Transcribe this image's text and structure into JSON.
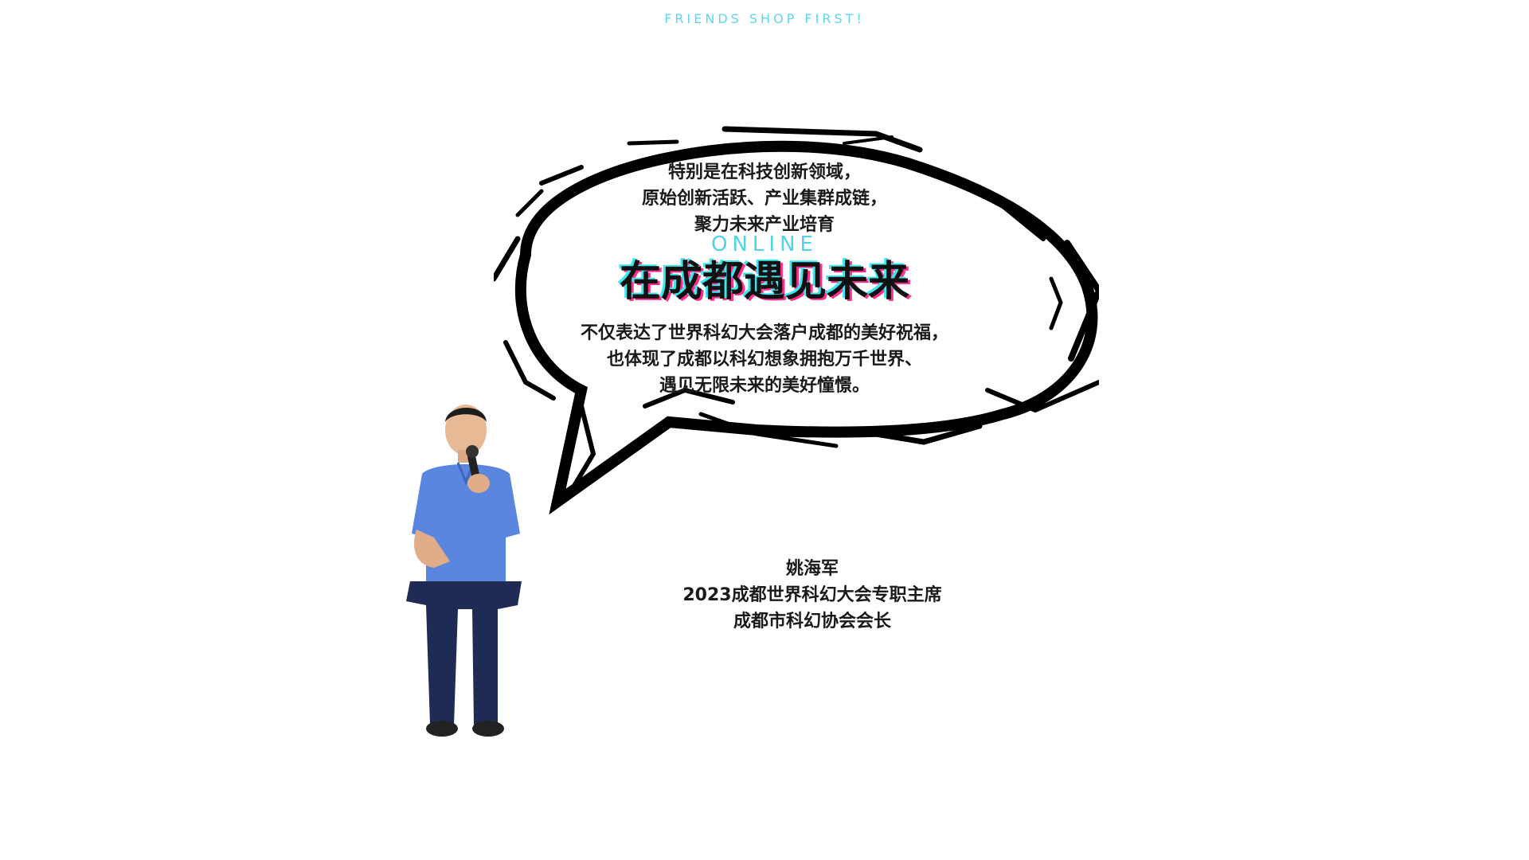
{
  "header": {
    "tagline": "FRIENDS SHOP FIRST!"
  },
  "bubble": {
    "intro": [
      "特别是在科技创新领域，",
      "原始创新活跃、产业集群成链，",
      "聚力未来产业培育"
    ],
    "online_label": "ONLINE",
    "headline": "在成都遇见未来",
    "details": [
      "不仅表达了世界科幻大会落户成都的美好祝福，",
      "也体现了成都以科幻想象拥抱万千世界、",
      "遇见无限未来的美好憧憬。"
    ]
  },
  "speaker": {
    "name": "姚海军",
    "title_1": "2023成都世界科幻大会专职主席",
    "title_2": "成都市科幻协会会长"
  },
  "colors": {
    "accent_cyan": "#4fd3e8",
    "accent_magenta": "#ff2d8a",
    "shirt_blue": "#5b86e0",
    "pants_navy": "#1f2a55"
  }
}
